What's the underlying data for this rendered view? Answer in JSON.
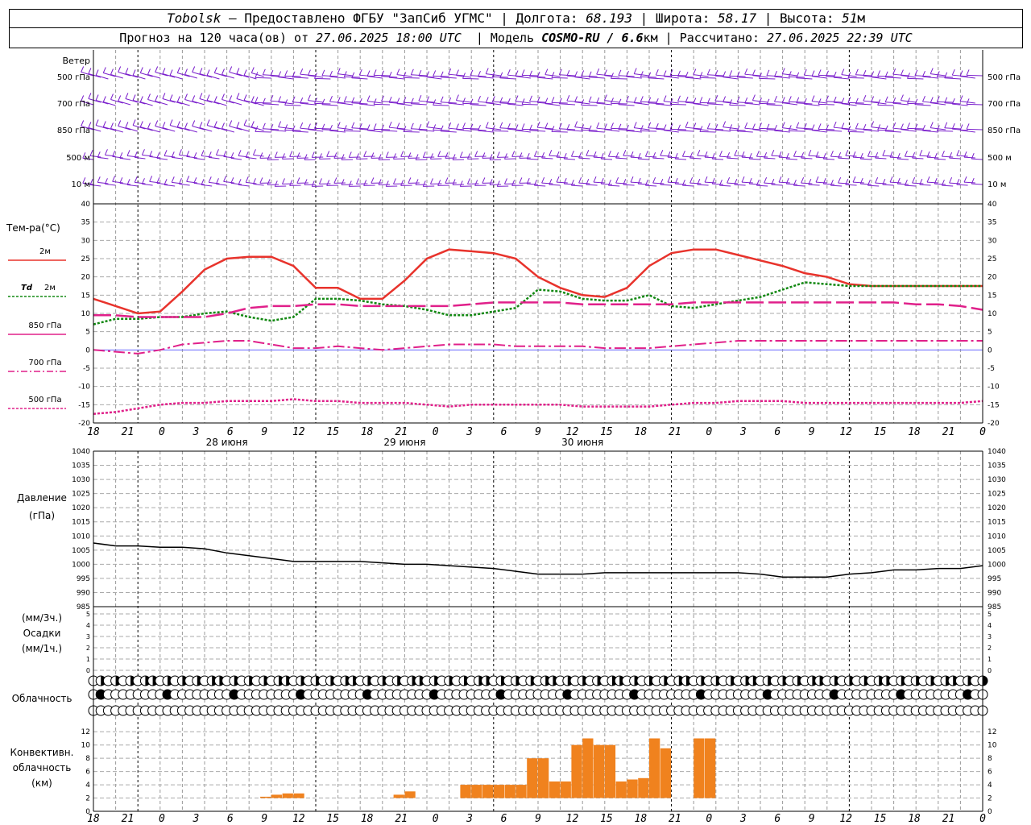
{
  "header": {
    "station": "Tobolsk",
    "dash": "—",
    "provider": "Предоставлено ФГБУ \"ЗапСиб УГМС\"",
    "lon_label": "Долгота:",
    "lon_value": "68.193",
    "lat_label": "Широта:",
    "lat_value": "58.17",
    "alt_label": "Высота:",
    "alt_value": "51",
    "alt_unit": "м",
    "forecast_text": "Прогноз на 120 часа(ов) от",
    "forecast_start": "27.06.2025 18:00 UTC",
    "model_label": "Модель",
    "model_name": "COSMO-RU / 6.6",
    "model_unit": "км",
    "computed_label": "Рассчитано:",
    "computed_time": "27.06.2025 22:39 UTC"
  },
  "axis": {
    "hour_ticks": [
      "18",
      "21",
      "0",
      "3",
      "6",
      "9",
      "12",
      "15",
      "18",
      "21",
      "0",
      "3",
      "6",
      "9",
      "12",
      "15",
      "18",
      "21",
      "0",
      "3",
      "6",
      "9",
      "12",
      "15",
      "18",
      "21",
      "0"
    ],
    "day_labels": [
      "28 июня",
      "29 июня",
      "30 июня"
    ]
  },
  "wind": {
    "title": "Ветер",
    "levels": [
      "500 гПа",
      "700 гПа",
      "850 гПа",
      "500 м",
      "10  м"
    ],
    "color": "#7a1ecc"
  },
  "temperature": {
    "title": "Тем-ра(°С)",
    "ticks": [
      "40",
      "35",
      "30",
      "25",
      "20",
      "15",
      "10",
      "5",
      "0",
      "-5",
      "-10",
      "-15",
      "-20"
    ],
    "legend": {
      "t2m": "2м",
      "td_label": "Td",
      "td_level": "2м",
      "t850": "850 гПа",
      "t700": "700 гПа",
      "t500": "500 гПа"
    },
    "colors": {
      "t2m": "#e8332c",
      "td": "#118811",
      "t850": "#e0208a",
      "t700": "#e0208a",
      "t500": "#e0208a"
    }
  },
  "pressure": {
    "title": "Давление",
    "unit": "(гПа)",
    "ticks": [
      "1040",
      "1035",
      "1030",
      "1025",
      "1020",
      "1015",
      "1010",
      "1005",
      "1000",
      "995",
      "990",
      "985"
    ]
  },
  "precip": {
    "unit3": "(мм/3ч.)",
    "title": "Осадки",
    "unit1": "(мм/1ч.)",
    "ticks": [
      "5",
      "4",
      "3",
      "2",
      "1",
      "0"
    ]
  },
  "clouds": {
    "title": "Облачность"
  },
  "convective": {
    "title1": "Конвективн.",
    "title2": "облачность",
    "unit": "(км)",
    "ticks": [
      "12",
      "10",
      "8",
      "6",
      "4",
      "2",
      "0"
    ],
    "color": "#f0821e"
  },
  "chart_data": [
    {
      "type": "line",
      "title": "Тем-ра(°С)",
      "x": [
        0,
        3,
        6,
        9,
        12,
        15,
        18,
        21,
        24,
        27,
        30,
        33,
        36,
        39,
        42,
        45,
        48,
        51,
        54,
        57,
        60,
        63,
        66,
        69,
        72,
        75,
        78,
        81,
        84,
        87,
        90,
        93,
        96,
        99,
        102,
        105,
        108,
        111,
        114,
        117,
        120
      ],
      "ylim": [
        -20,
        40
      ],
      "series": [
        {
          "name": "2м",
          "values": [
            14,
            12,
            10,
            10.5,
            16,
            22,
            25,
            25.5,
            25.5,
            23,
            17,
            17,
            14,
            14,
            19,
            25,
            27.5,
            27,
            26.5,
            25,
            20,
            17,
            15,
            14.5,
            17,
            23,
            26.5,
            27.5,
            27.5,
            26,
            24.5,
            23,
            21,
            20,
            18,
            17.5,
            17.5,
            17.5,
            17.5,
            17.5,
            17.5
          ]
        },
        {
          "name": "Td 2м",
          "values": [
            7,
            8.5,
            8.5,
            9,
            9,
            10,
            10.5,
            9,
            8,
            9,
            14,
            14,
            13.5,
            12.5,
            12,
            11,
            9.5,
            9.5,
            10.5,
            11.5,
            16.5,
            16,
            14,
            13.5,
            13.5,
            15,
            12,
            11.5,
            12.5,
            13.5,
            14.5,
            16.5,
            18.5,
            18,
            17.5,
            17.5,
            17.5,
            17.5,
            17.5,
            17.5,
            17.5
          ]
        },
        {
          "name": "850 гПа",
          "values": [
            9.5,
            9.5,
            9,
            9,
            9,
            9,
            10,
            11.5,
            12,
            12,
            12.5,
            12.5,
            12,
            12,
            12,
            12,
            12,
            12.5,
            13,
            13,
            13,
            13,
            12.5,
            12.5,
            12.5,
            12.5,
            12.5,
            13,
            13,
            13,
            13,
            13,
            13,
            13,
            13,
            13,
            13,
            12.5,
            12.5,
            12,
            11
          ]
        },
        {
          "name": "700 гПа",
          "values": [
            0,
            -0.5,
            -1,
            0,
            1.5,
            2,
            2.5,
            2.5,
            1.5,
            0.5,
            0.5,
            1,
            0.5,
            0,
            0.5,
            1,
            1.5,
            1.5,
            1.5,
            1,
            1,
            1,
            1,
            0.5,
            0.5,
            0.5,
            1,
            1.5,
            2,
            2.5,
            2.5,
            2.5,
            2.5,
            2.5,
            2.5,
            2.5,
            2.5,
            2.5,
            2.5,
            2.5,
            2.5
          ]
        },
        {
          "name": "500 гПа",
          "values": [
            -17.5,
            -17,
            -16,
            -15,
            -14.5,
            -14.5,
            -14,
            -14,
            -14,
            -13.5,
            -14,
            -14,
            -14.5,
            -14.5,
            -14.5,
            -15,
            -15.5,
            -15,
            -15,
            -15,
            -15,
            -15,
            -15.5,
            -15.5,
            -15.5,
            -15.5,
            -15,
            -14.5,
            -14.5,
            -14,
            -14,
            -14,
            -14.5,
            -14.5,
            -14.5,
            -14.5,
            -14.5,
            -14.5,
            -14.5,
            -14.5,
            -14
          ]
        }
      ]
    },
    {
      "type": "line",
      "title": "Давление",
      "ylabel": "(гПа)",
      "x": [
        0,
        3,
        6,
        9,
        12,
        15,
        18,
        21,
        24,
        27,
        30,
        33,
        36,
        39,
        42,
        45,
        48,
        51,
        54,
        57,
        60,
        63,
        66,
        69,
        72,
        75,
        78,
        81,
        84,
        87,
        90,
        93,
        96,
        99,
        102,
        105,
        108,
        111,
        114,
        117,
        120
      ],
      "ylim": [
        985,
        1040
      ],
      "series": [
        {
          "name": "",
          "values": [
            1007.5,
            1006.5,
            1006.5,
            1006,
            1006,
            1005.5,
            1004,
            1003,
            1002,
            1001,
            1001,
            1001,
            1001,
            1000.5,
            1000,
            1000,
            999.5,
            999,
            998.5,
            997.5,
            996.5,
            996.5,
            996.5,
            997,
            997,
            997,
            997,
            997,
            997,
            997,
            996.5,
            995.5,
            995.5,
            995.5,
            996.5,
            997,
            998,
            998,
            998.5,
            998.5,
            999.5
          ]
        }
      ]
    },
    {
      "type": "bar",
      "title": "Конвективн. облачность",
      "ylabel": "(км)",
      "ylim": [
        0,
        13
      ],
      "x": [
        15,
        16,
        17,
        18,
        27,
        28,
        33,
        34,
        35,
        36,
        37,
        38,
        39,
        40,
        41,
        42,
        43,
        44,
        45,
        46,
        47,
        48,
        49,
        50,
        51,
        52,
        53,
        54,
        55,
        56,
        57,
        58,
        59,
        60,
        61,
        62
      ],
      "bottom": [
        2,
        2,
        2,
        2,
        2,
        2,
        2,
        2,
        2,
        2,
        2,
        2,
        2,
        2,
        2,
        2,
        2,
        2,
        2,
        2,
        2,
        2,
        2,
        2,
        2,
        2,
        2,
        2,
        2,
        2,
        2,
        2,
        2,
        2,
        2,
        2
      ],
      "top": [
        2.2,
        2.5,
        2.7,
        2.7,
        2.5,
        3,
        4,
        4,
        4,
        4,
        4,
        4,
        8,
        8,
        4.5,
        4.5,
        10,
        11,
        10,
        10,
        4.5,
        4.8,
        5,
        11,
        9.5,
        2,
        2,
        11,
        11,
        0,
        0,
        0,
        0,
        0,
        0,
        0
      ]
    }
  ]
}
